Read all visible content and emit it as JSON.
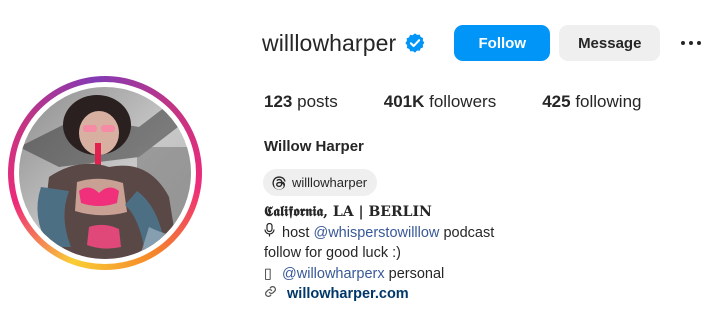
{
  "profile": {
    "username": "willlowharper",
    "verified": true,
    "full_name": "Willow Harper",
    "threads_handle": "willlowharper"
  },
  "actions": {
    "follow_label": "Follow",
    "message_label": "Message"
  },
  "stats": {
    "posts": {
      "count": "123",
      "label": "posts"
    },
    "followers": {
      "count": "401K",
      "label": "followers"
    },
    "following": {
      "count": "425",
      "label": "following"
    }
  },
  "bio": {
    "location_line": "𝕮𝖆𝖑𝖎𝖋𝖔𝖗𝖓𝖎𝖆, LA | BERLIN",
    "line2_prefix": "host",
    "line2_mention": "@whisperstowilllow",
    "line2_suffix": "podcast",
    "line3": "follow for good luck :)",
    "line4_glyph": "▯",
    "line4_mention": "@willowharperx",
    "line4_suffix": "personal",
    "website": "willowharper.com"
  },
  "icons": {
    "verified": "verified-badge-icon",
    "threads": "threads-icon",
    "more": "more-options-icon",
    "link": "link-icon",
    "mic": "microphone-icon"
  },
  "colors": {
    "follow_button": "#0095f6",
    "verified_badge": "#0095f6",
    "message_button": "#efefef",
    "mention": "#385898",
    "link": "#00376b"
  }
}
